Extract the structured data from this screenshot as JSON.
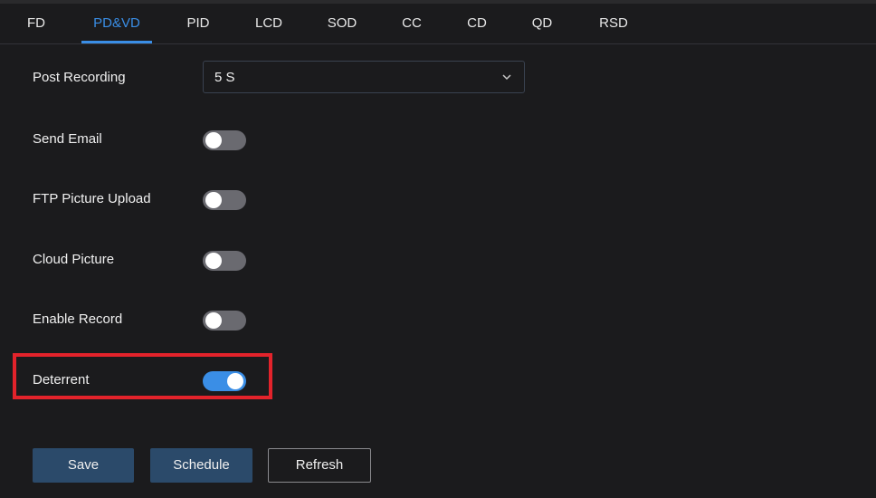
{
  "tabs": [
    {
      "label": "FD"
    },
    {
      "label": "PD&VD"
    },
    {
      "label": "PID"
    },
    {
      "label": "LCD"
    },
    {
      "label": "SOD"
    },
    {
      "label": "CC"
    },
    {
      "label": "CD"
    },
    {
      "label": "QD"
    },
    {
      "label": "RSD"
    }
  ],
  "active_tab": "PD&VD",
  "accent_color": "#3a8ee6",
  "highlight_color": "#e3232b",
  "settings": {
    "post_recording": {
      "label": "Post Recording",
      "value": "5 S"
    },
    "send_email": {
      "label": "Send Email",
      "enabled": false
    },
    "ftp_picture_upload": {
      "label": "FTP Picture Upload",
      "enabled": false
    },
    "cloud_picture": {
      "label": "Cloud Picture",
      "enabled": false
    },
    "enable_record": {
      "label": "Enable Record",
      "enabled": false
    },
    "deterrent": {
      "label": "Deterrent",
      "enabled": true
    }
  },
  "buttons": {
    "save": "Save",
    "schedule": "Schedule",
    "refresh": "Refresh"
  }
}
